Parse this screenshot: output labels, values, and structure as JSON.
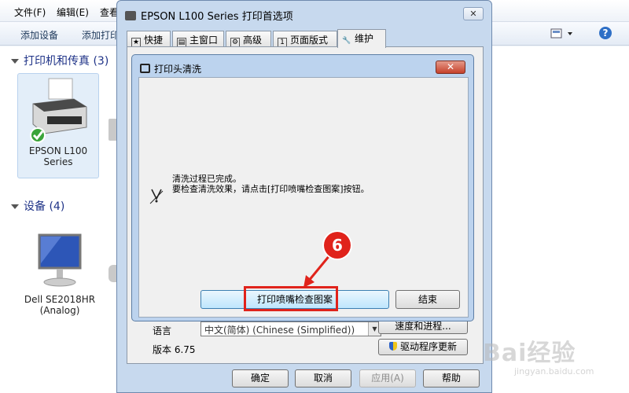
{
  "background_window": {
    "menu": [
      "文件(F)",
      "编辑(E)",
      "查看"
    ],
    "toolbar": {
      "add_device": "添加设备",
      "add_printer": "添加打印"
    },
    "sections": {
      "printers": "打印机和传真 (3)",
      "devices": "设备 (4)"
    },
    "printer_tile": {
      "line1": "EPSON L100",
      "line2": "Series"
    },
    "monitor_tile": {
      "line1": "Dell SE2018HR",
      "line2": "(Analog)"
    }
  },
  "epson_dialog": {
    "title": "EPSON L100 Series 打印首选项",
    "close_glyph": "✕",
    "tabs": [
      {
        "label": "快捷",
        "icon": "star-icon"
      },
      {
        "label": "主窗口",
        "icon": "printer-icon"
      },
      {
        "label": "高级",
        "icon": "gear-icon"
      },
      {
        "label": "页面版式",
        "icon": "page-icon"
      },
      {
        "label": "维护",
        "icon": "wrench-icon",
        "active": true
      }
    ],
    "language_label": "语言",
    "language_value": "中文(简体) (Chinese (Simplified))",
    "speed_progress_button": "速度和进程...",
    "version_label": "版本 6.75",
    "driver_update_button": "驱动程序更新",
    "ok_button": "确定",
    "cancel_button": "取消",
    "apply_button": "应用(A)",
    "help_button": "帮助"
  },
  "cleaning_dialog": {
    "title": "打印头清洗",
    "close_glyph": "✕",
    "message_line1": "清洗过程已完成。",
    "message_line2": "要检查清洗效果，请点击[打印喷嘴检查图案]按钮。",
    "check_pattern_button": "打印喷嘴检查图案",
    "finish_button": "结束"
  },
  "annotation": {
    "step_number": "6",
    "color": "#e0231b"
  },
  "watermark": {
    "main": "Bai经验",
    "sub": "jingyan.baidu.com"
  }
}
